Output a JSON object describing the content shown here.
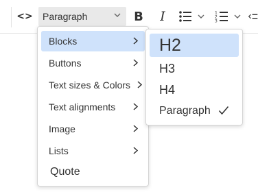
{
  "toolbar": {
    "code_label": "<>",
    "paragraph_select": "Paragraph",
    "bold_label": "B",
    "italic_label": "I"
  },
  "menu": {
    "items": [
      {
        "label": "Blocks"
      },
      {
        "label": "Buttons"
      },
      {
        "label": "Text sizes & Colors"
      },
      {
        "label": "Text alignments"
      },
      {
        "label": "Image"
      },
      {
        "label": "Lists"
      },
      {
        "label": "Quote"
      }
    ]
  },
  "submenu": {
    "items": [
      {
        "label": "H2"
      },
      {
        "label": "H3"
      },
      {
        "label": "H4"
      },
      {
        "label": "Paragraph",
        "selected": true
      }
    ]
  },
  "colors": {
    "highlight": "#cfe2fb",
    "select_bg": "#e9e9e9",
    "border": "#d5d5d5"
  }
}
